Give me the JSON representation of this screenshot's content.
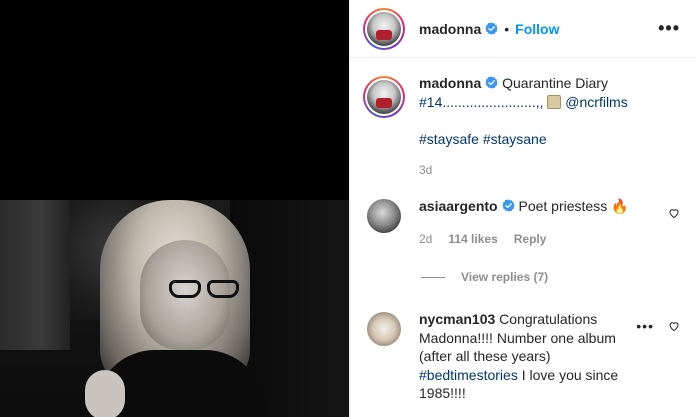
{
  "header": {
    "username": "madonna",
    "separator": "•",
    "follow_label": "Follow",
    "more_label": "•••"
  },
  "caption": {
    "username": "madonna",
    "text_line1": "Quarantine Diary",
    "hashtag": "#14",
    "dots": "........................,,",
    "mention": "@ncrfilms",
    "hashtags2": "#staysafe #staysane",
    "time": "3d"
  },
  "comments": [
    {
      "username": "asiaargento",
      "text": "Poet priestess 🔥",
      "time": "2d",
      "likes": "114 likes",
      "reply": "Reply"
    },
    {
      "username": "nycman103",
      "text": "Congratulations Madonna!!!! Number one album (after all these years)",
      "hashtag": "#bedtimestories",
      "text_after": " I love you since 1985!!!!"
    }
  ],
  "view_replies": "View replies (7)",
  "colors": {
    "accent": "#0095f6",
    "link": "#00376b",
    "muted": "#8e8e8e",
    "verified": "#3897f0"
  },
  "icons": {
    "verified": "verified-badge-icon",
    "heart": "heart-outline-icon",
    "more": "more-horizontal-icon"
  }
}
